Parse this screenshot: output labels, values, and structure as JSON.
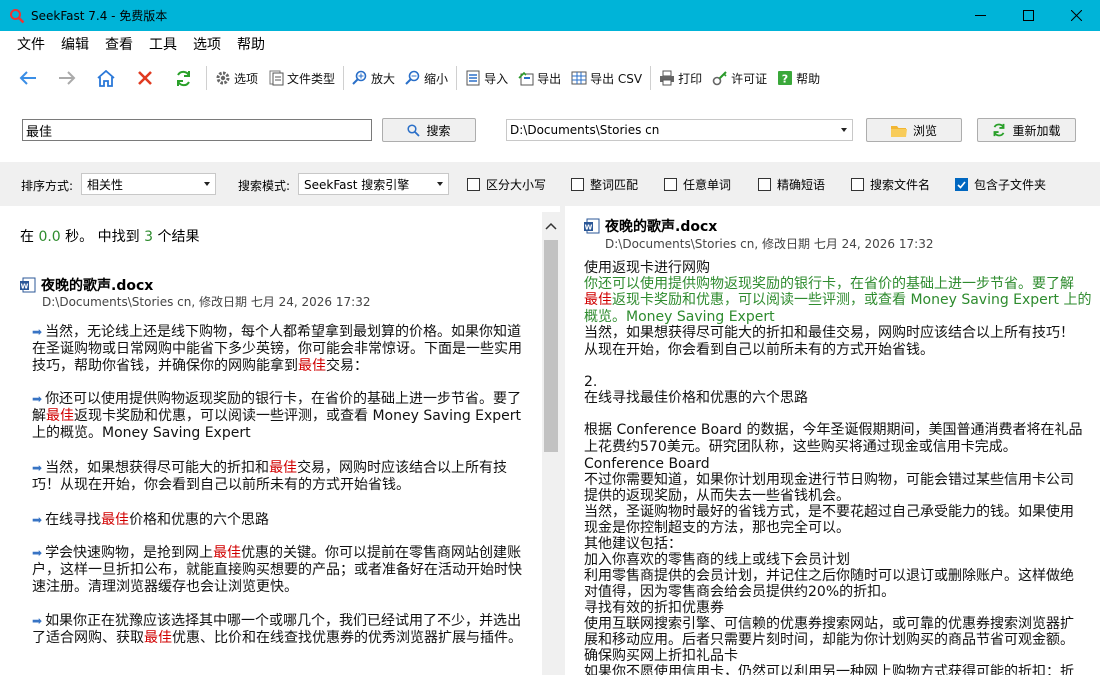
{
  "window": {
    "title": "SeekFast 7.4 - 免费版本"
  },
  "menu": [
    "文件",
    "编辑",
    "查看",
    "工具",
    "选项",
    "帮助"
  ],
  "toolbar": {
    "options": "选项",
    "file_types": "文件类型",
    "zoom_in": "放大",
    "zoom_out": "缩小",
    "import": "导入",
    "export": "导出",
    "export_csv": "导出 CSV",
    "print": "打印",
    "license": "许可证",
    "help": "帮助"
  },
  "search": {
    "query": "最佳",
    "search_button": "搜索",
    "folder": "D:\\Documents\\Stories cn",
    "browse_button": "浏览",
    "reload_button": "重新加载"
  },
  "options": {
    "sort_label": "排序方式:",
    "sort_value": "相关性",
    "mode_label": "搜索模式:",
    "mode_value": "SeekFast 搜索引擎",
    "case": "区分大小写",
    "whole_word": "整词匹配",
    "any_word": "任意单词",
    "exact_phrase": "精确短语",
    "search_filenames": "搜索文件名",
    "include_subfolders": "包含子文件夹",
    "include_subfolders_checked": true
  },
  "results": {
    "prefix": "在",
    "time": "0.0",
    "mid": "秒。 中找到",
    "count": "3",
    "suffix": "个结果",
    "file_name": "夜晚的歌声.docx",
    "file_path": "D:\\Documents\\Stories cn, 修改日期 七月 24, 2026 17:32",
    "highlight": "最佳",
    "snippets": [
      [
        "当然，无论线上还是线下购物，每个人都希望拿到最划算的价格。如果你知",
        "道在圣诞购物或日常网购中能省下多少英镑，你可能会非常惊讶。下面是一些实",
        "用技巧，帮助你省钱，并确保你的网购能拿到",
        "交易："
      ],
      [
        "你还可以使用提供购物返现奖励的银行卡，在省价的基础上进一步节省。要",
        "了解",
        "返现卡奖励和优惠，可以阅读一些评测，或查看 Money Saving Expert",
        "上的概览。Money Saving Expert"
      ],
      [
        "当然，如果想获得尽可能大的折扣和",
        "交易，网购时应该结合以上所有技巧！从现在开始，你会看到自己以前所未有的方式开始省钱。"
      ],
      [
        "在线寻找",
        "价格和优惠的六个思路"
      ],
      [
        "学会快速购物，是抢到网上",
        "优惠的关键。你可以提前在零售商网站创建",
        "账户，这样一旦折扣公布，就能直接购买想要的产品；或者准备好在活动开始时",
        "快速注册。清理浏览器缓存也会让浏览更快。"
      ],
      [
        "如果你正在犹豫应该选择其中哪一个或哪几个，我们已经试用了不少，并选",
        "出了适合网购、获取",
        "优惠、比价和在线查找优惠券的优秀浏览器扩展与插",
        "件。"
      ]
    ]
  },
  "preview": {
    "file_name": "夜晚的歌声.docx",
    "file_path": "D:\\Documents\\Stories cn, 修改日期 七月 24, 2026 17:32",
    "lines": [
      "使用返现卡进行网购",
      "你还可以使用提供购物返现奖励的银行卡，在省价的基础上进一步节省。要了解",
      "返现卡奖励和优惠，可以阅读一些评测，或查看 Money Saving Expert 上的",
      "概览。Money Saving Expert",
      "当然，如果想获得尽可能大的折扣和最佳交易，网购时应该结合以上所有技巧！",
      "从现在开始，你会看到自己以前所未有的方式开始省钱。",
      "2.",
      "在线寻找最佳价格和优惠的六个思路",
      "根据 Conference Board 的数据，今年圣诞假期期间，美国普通消费者将在礼品",
      "上花费约570美元。研究团队称，这些购买将通过现金或信用卡完成。",
      "Conference Board",
      "不过你需要知道，如果你计划用现金进行节日购物，可能会错过某些信用卡公司",
      "提供的返现奖励，从而失去一些省钱机会。",
      "当然，圣诞购物时最好的省钱方式，是不要花超过自己承受能力的钱。如果使用",
      "现金是你控制超支的方法，那也完全可以。",
      "其他建议包括：",
      "加入你喜欢的零售商的线上或线下会员计划",
      "利用零售商提供的会员计划，并记住之后你随时可以退订或删除账户。这样做绝",
      "对值得，因为零售商会给会员提供约20%的折扣。",
      "寻找有效的折扣优惠券",
      "使用互联网搜索引擎、可信赖的优惠券搜索网站，或可靠的优惠券搜索浏览器扩",
      "展和移动应用。后者只需要片刻时间，却能为你计划购买的商品节省可观金额。",
      "确保购买网上折扣礼品卡",
      "如果你不愿使用信用卡，仍然可以利用另一种网上购物方式获得可能的折扣：折"
    ]
  }
}
